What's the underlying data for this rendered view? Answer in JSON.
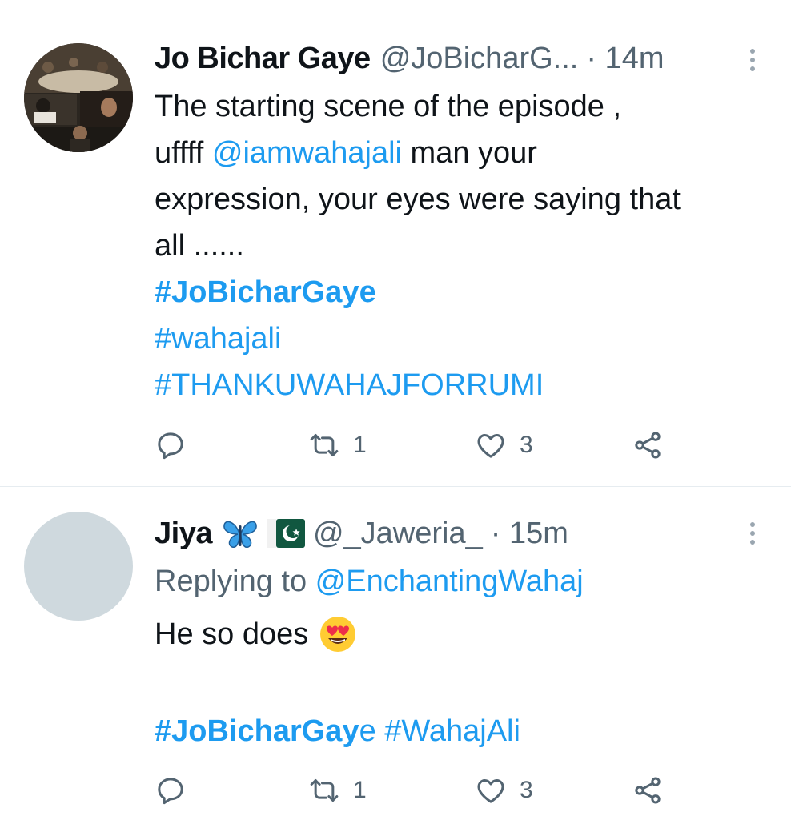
{
  "tweets": [
    {
      "name": "Jo Bichar Gaye",
      "handle": "@JoBicharG...",
      "time": "· 14m",
      "lines": [
        "The starting scene of the episode ,",
        "uffff ",
        "@iamwahajali",
        " man your",
        "expression, your eyes were saying that",
        "all ......"
      ],
      "hashtags": [
        "#JoBicharGaye",
        "#wahajali",
        "#THANKUWAHAJFORRUMI"
      ],
      "retweets": "1",
      "likes": "3"
    },
    {
      "name": "Jiya",
      "emojis": [
        "butterfly-emoji",
        "pakistan-flag-emoji"
      ],
      "handle": "@_Jaweria_",
      "time": "· 15m",
      "replying_prefix": "Replying to ",
      "replying_to": "@EnchantingWahaj",
      "text": "He so does",
      "text_emoji": "heart-eyes-emoji",
      "hashtag_bold": "#JoBicharGay",
      "hashtag_tail": "e #WahajAli",
      "retweets": "1",
      "likes": "3"
    }
  ],
  "colors": {
    "link": "#1d9bf0",
    "secondary": "#536471",
    "divider": "#e6ecf0",
    "placeholder_avatar": "#cfd9de"
  },
  "icons": [
    "reply-icon",
    "retweet-icon",
    "like-icon",
    "share-icon",
    "more-icon"
  ]
}
